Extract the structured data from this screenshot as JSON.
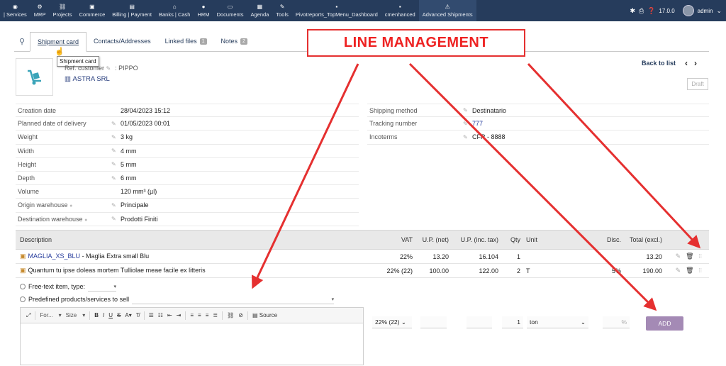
{
  "nav": {
    "items": [
      {
        "label": "| Services",
        "icon": "services-icon"
      },
      {
        "label": "MRP",
        "icon": "mrp-icon"
      },
      {
        "label": "Projects",
        "icon": "projects-icon"
      },
      {
        "label": "Commerce",
        "icon": "commerce-icon"
      },
      {
        "label": "Billing | Payment",
        "icon": "billing-icon"
      },
      {
        "label": "Banks | Cash",
        "icon": "bank-icon"
      },
      {
        "label": "HRM",
        "icon": "hrm-icon"
      },
      {
        "label": "Documents",
        "icon": "documents-icon"
      },
      {
        "label": "Agenda",
        "icon": "agenda-icon"
      },
      {
        "label": "Tools",
        "icon": "tools-icon"
      },
      {
        "label": "Pivotreports_TopMenu_Dashboard",
        "icon": "dashboard-icon"
      },
      {
        "label": "cmenhanced",
        "icon": "cmenhanced-icon"
      },
      {
        "label": "Advanced Shipments",
        "icon": "shipments-icon"
      }
    ],
    "version": "17.0.0",
    "user": "admin"
  },
  "tabs": [
    {
      "label": "Shipment card",
      "badge": ""
    },
    {
      "label": "Contacts/Addresses",
      "badge": ""
    },
    {
      "label": "Linked files",
      "badge": "1"
    },
    {
      "label": "Notes",
      "badge": "2"
    }
  ],
  "tooltip": "Shipment card",
  "annotation": "LINE MANAGEMENT",
  "header": {
    "ref_label": "Ref. customer",
    "ref_value": ": PIPPO",
    "thirdparty": "ASTRA SRL",
    "back_to_list": "Back to list",
    "status": "Draft"
  },
  "fields_left": [
    {
      "label": "Creation date",
      "value": "28/04/2023 15:12",
      "editable": false,
      "help": false
    },
    {
      "label": "Planned date of delivery",
      "value": "01/05/2023 00:01",
      "editable": true,
      "help": false
    },
    {
      "label": "Weight",
      "value": "3 kg",
      "editable": true,
      "help": false
    },
    {
      "label": "Width",
      "value": "4 mm",
      "editable": true,
      "help": false
    },
    {
      "label": "Height",
      "value": "5 mm",
      "editable": true,
      "help": false
    },
    {
      "label": "Depth",
      "value": "6 mm",
      "editable": true,
      "help": false
    },
    {
      "label": "Volume",
      "value": "120 mm³ (µl)",
      "editable": false,
      "help": false
    },
    {
      "label": "Origin warehouse",
      "value": "Principale",
      "editable": true,
      "help": true
    },
    {
      "label": "Destination warehouse",
      "value": "Prodotti Finiti",
      "editable": true,
      "help": true
    }
  ],
  "fields_right": [
    {
      "label": "Shipping method",
      "value": "Destinatario",
      "link": false
    },
    {
      "label": "Tracking number",
      "value": "777",
      "link": true
    },
    {
      "label": "Incoterms",
      "value": "CFR - 8888",
      "link": false
    }
  ],
  "lines": {
    "headers": {
      "desc": "Description",
      "vat": "VAT",
      "upn": "U.P. (net)",
      "upt": "U.P. (inc. tax)",
      "qty": "Qty",
      "unit": "Unit",
      "disc": "Disc.",
      "tot": "Total (excl.)"
    },
    "rows": [
      {
        "ref": "MAGLIA_XS_BLU",
        "label": " - Maglia Extra small Blu",
        "vat": "22%",
        "upn": "13.20",
        "upt": "16.104",
        "qty": "1",
        "unit": "",
        "disc": "",
        "tot": "13.20"
      },
      {
        "ref": "",
        "label": "Quantum tu ipse doleas mortem Tulliolae meae facile ex litteris",
        "vat": "22% (22)",
        "upn": "100.00",
        "upt": "122.00",
        "qty": "2",
        "unit": "T",
        "disc": "5%",
        "tot": "190.00"
      }
    ]
  },
  "addform": {
    "free_text_label": "Free-text item, type:",
    "predefined_label": "Predefined products/services to sell",
    "toolbar": {
      "font": "For...",
      "size": "Size",
      "source": "Source"
    },
    "vat": "22% (22)",
    "qty": "1",
    "unit": "ton",
    "disc_suffix": "%",
    "add_label": "ADD"
  }
}
